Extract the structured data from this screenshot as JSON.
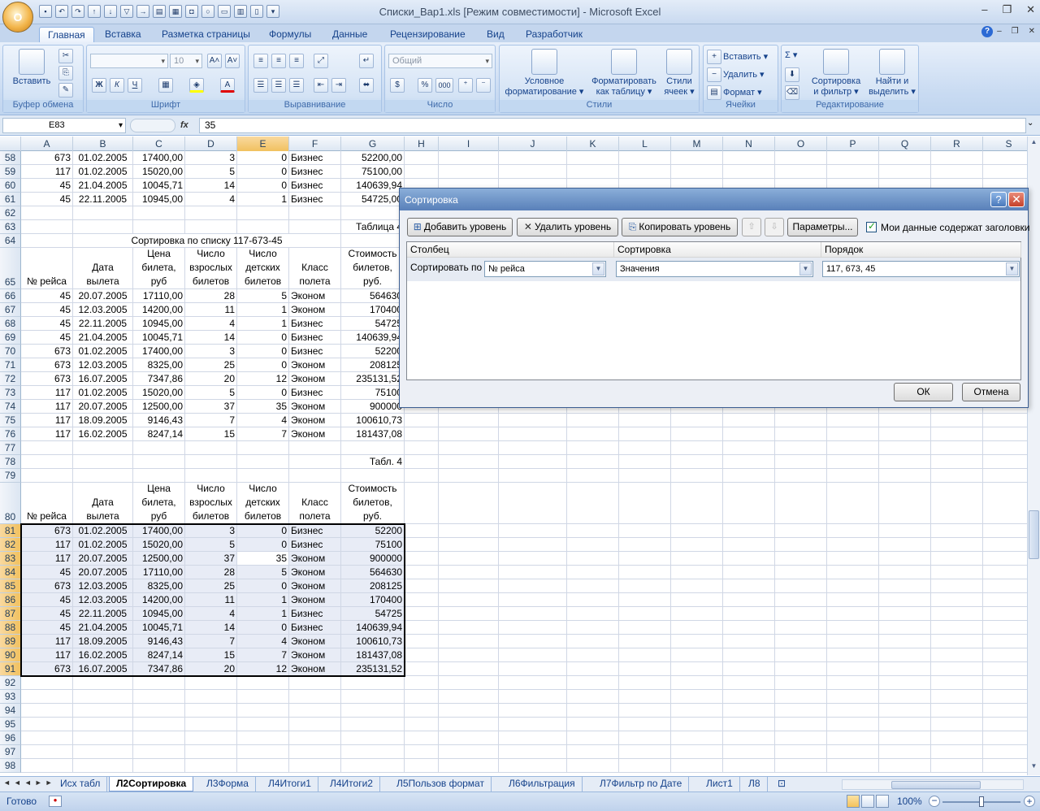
{
  "window": {
    "title": "Списки_Вар1.xls  [Режим совместимости] - Microsoft Excel",
    "minimize": "‒",
    "restore": "❐",
    "close": "✕"
  },
  "office_button": "O",
  "ribbon": {
    "tabs": [
      "Главная",
      "Вставка",
      "Разметка страницы",
      "Формулы",
      "Данные",
      "Рецензирование",
      "Вид",
      "Разработчик"
    ],
    "active_tab": "Главная",
    "groups": {
      "clipboard": {
        "label": "Буфер обмена",
        "paste": "Вставить"
      },
      "font": {
        "label": "Шрифт",
        "font_name": "",
        "font_size": "10",
        "bold": "Ж",
        "italic": "К",
        "underline": "Ч",
        "grow": "A˄",
        "shrink": "A˅"
      },
      "alignment": {
        "label": "Выравнивание"
      },
      "number": {
        "label": "Число",
        "format": "Общий",
        "percent": "%",
        "thousands": "000"
      },
      "styles": {
        "label": "Стили",
        "conditional_1": "Условное",
        "conditional_2": "форматирование ▾",
        "table_1": "Форматировать",
        "table_2": "как таблицу ▾",
        "cell_1": "Стили",
        "cell_2": "ячеек ▾"
      },
      "cells": {
        "label": "Ячейки",
        "insert": "Вставить ▾",
        "delete": "Удалить ▾",
        "format": "Формат ▾"
      },
      "editing": {
        "label": "Редактирование",
        "sigma": "Σ ▾",
        "sort_1": "Сортировка",
        "sort_2": "и фильтр ▾",
        "find_1": "Найти и",
        "find_2": "выделить ▾"
      }
    }
  },
  "formula_bar": {
    "name_box": "E83",
    "fx": "fx",
    "value": "35"
  },
  "grid": {
    "columns": [
      "A",
      "B",
      "C",
      "D",
      "E",
      "F",
      "G",
      "H",
      "I",
      "J",
      "K",
      "L",
      "M",
      "N",
      "O",
      "P",
      "Q",
      "R",
      "S"
    ],
    "selected_column": "E",
    "headers_row": [
      "№ рейса",
      "Дата вылета",
      "Цена билета, руб",
      "Число взрослых билетов",
      "Число детских билетов",
      "Класс полета",
      "Стоимость билетов, руб."
    ],
    "rows_top": [
      {
        "n": "58",
        "a": "673",
        "b": "01.02.2005",
        "c": "17400,00",
        "d": "3",
        "e": "0",
        "f": "Бизнес",
        "g": "52200,00"
      },
      {
        "n": "59",
        "a": "117",
        "b": "01.02.2005",
        "c": "15020,00",
        "d": "5",
        "e": "0",
        "f": "Бизнес",
        "g": "75100,00"
      },
      {
        "n": "60",
        "a": "45",
        "b": "21.04.2005",
        "c": "10045,71",
        "d": "14",
        "e": "0",
        "f": "Бизнес",
        "g": "140639,94"
      },
      {
        "n": "61",
        "a": "45",
        "b": "22.11.2005",
        "c": "10945,00",
        "d": "4",
        "e": "1",
        "f": "Бизнес",
        "g": "54725,00"
      }
    ],
    "row62": "62",
    "row63": {
      "n": "63",
      "label": "Таблица 4"
    },
    "row64": {
      "n": "64",
      "label": "Сортировка по списку 117-673-45"
    },
    "row65": "65",
    "rows_mid": [
      {
        "n": "66",
        "a": "45",
        "b": "20.07.2005",
        "c": "17110,00",
        "d": "28",
        "e": "5",
        "f": "Эконом",
        "g": "564630"
      },
      {
        "n": "67",
        "a": "45",
        "b": "12.03.2005",
        "c": "14200,00",
        "d": "11",
        "e": "1",
        "f": "Эконом",
        "g": "170400"
      },
      {
        "n": "68",
        "a": "45",
        "b": "22.11.2005",
        "c": "10945,00",
        "d": "4",
        "e": "1",
        "f": "Бизнес",
        "g": "54725"
      },
      {
        "n": "69",
        "a": "45",
        "b": "21.04.2005",
        "c": "10045,71",
        "d": "14",
        "e": "0",
        "f": "Бизнес",
        "g": "140639,94"
      },
      {
        "n": "70",
        "a": "673",
        "b": "01.02.2005",
        "c": "17400,00",
        "d": "3",
        "e": "0",
        "f": "Бизнес",
        "g": "52200"
      },
      {
        "n": "71",
        "a": "673",
        "b": "12.03.2005",
        "c": "8325,00",
        "d": "25",
        "e": "0",
        "f": "Эконом",
        "g": "208125"
      },
      {
        "n": "72",
        "a": "673",
        "b": "16.07.2005",
        "c": "7347,86",
        "d": "20",
        "e": "12",
        "f": "Эконом",
        "g": "235131,52"
      },
      {
        "n": "73",
        "a": "117",
        "b": "01.02.2005",
        "c": "15020,00",
        "d": "5",
        "e": "0",
        "f": "Бизнес",
        "g": "75100"
      },
      {
        "n": "74",
        "a": "117",
        "b": "20.07.2005",
        "c": "12500,00",
        "d": "37",
        "e": "35",
        "f": "Эконом",
        "g": "900000"
      },
      {
        "n": "75",
        "a": "117",
        "b": "18.09.2005",
        "c": "9146,43",
        "d": "7",
        "e": "4",
        "f": "Эконом",
        "g": "100610,73"
      },
      {
        "n": "76",
        "a": "117",
        "b": "16.02.2005",
        "c": "8247,14",
        "d": "15",
        "e": "7",
        "f": "Эконом",
        "g": "181437,08"
      }
    ],
    "row77": "77",
    "row78": {
      "n": "78",
      "label": "Табл. 4"
    },
    "row79": "79",
    "row80": "80",
    "rows_bottom": [
      {
        "n": "81",
        "a": "673",
        "b": "01.02.2005",
        "c": "17400,00",
        "d": "3",
        "e": "0",
        "f": "Бизнес",
        "g": "52200"
      },
      {
        "n": "82",
        "a": "117",
        "b": "01.02.2005",
        "c": "15020,00",
        "d": "5",
        "e": "0",
        "f": "Бизнес",
        "g": "75100"
      },
      {
        "n": "83",
        "a": "117",
        "b": "20.07.2005",
        "c": "12500,00",
        "d": "37",
        "e": "35",
        "f": "Эконом",
        "g": "900000"
      },
      {
        "n": "84",
        "a": "45",
        "b": "20.07.2005",
        "c": "17110,00",
        "d": "28",
        "e": "5",
        "f": "Эконом",
        "g": "564630"
      },
      {
        "n": "85",
        "a": "673",
        "b": "12.03.2005",
        "c": "8325,00",
        "d": "25",
        "e": "0",
        "f": "Эконом",
        "g": "208125"
      },
      {
        "n": "86",
        "a": "45",
        "b": "12.03.2005",
        "c": "14200,00",
        "d": "11",
        "e": "1",
        "f": "Эконом",
        "g": "170400"
      },
      {
        "n": "87",
        "a": "45",
        "b": "22.11.2005",
        "c": "10945,00",
        "d": "4",
        "e": "1",
        "f": "Бизнес",
        "g": "54725"
      },
      {
        "n": "88",
        "a": "45",
        "b": "21.04.2005",
        "c": "10045,71",
        "d": "14",
        "e": "0",
        "f": "Бизнес",
        "g": "140639,94"
      },
      {
        "n": "89",
        "a": "117",
        "b": "18.09.2005",
        "c": "9146,43",
        "d": "7",
        "e": "4",
        "f": "Эконом",
        "g": "100610,73"
      },
      {
        "n": "90",
        "a": "117",
        "b": "16.02.2005",
        "c": "8247,14",
        "d": "15",
        "e": "7",
        "f": "Эконом",
        "g": "181437,08"
      },
      {
        "n": "91",
        "a": "673",
        "b": "16.07.2005",
        "c": "7347,86",
        "d": "20",
        "e": "12",
        "f": "Эконом",
        "g": "235131,52"
      }
    ],
    "empty_rows": [
      "92",
      "93",
      "94",
      "95",
      "96",
      "97",
      "98"
    ]
  },
  "dialog": {
    "title": "Сортировка",
    "help": "?",
    "close": "✕",
    "add_level": "Добавить уровень",
    "delete_level": "Удалить уровень",
    "copy_level": "Копировать уровень",
    "move_up": "⇧",
    "move_down": "⇩",
    "options": "Параметры...",
    "has_headers": "Мои данные содержат заголовки",
    "col_header_column": "Столбец",
    "col_header_sort": "Сортировка",
    "col_header_order": "Порядок",
    "sort_by": "Сортировать по",
    "column_value": "№ рейса",
    "sort_on_value": "Значения",
    "order_value": "117, 673, 45",
    "ok": "ОК",
    "cancel": "Отмена"
  },
  "sheet_tabs": {
    "nav": "◄◄◄►►",
    "tabs": [
      "Исх табл",
      "Л2Сортировка",
      "Л3Форма",
      "Л4Итоги1",
      "Л4Итоги2",
      "Л5Пользов формат",
      "Л6Фильтрация",
      "Л7Фильтр по Дате",
      "Лист1",
      "Л8"
    ],
    "active": "Л2Сортировка"
  },
  "status": {
    "ready": "Готово",
    "zoom": "100%"
  }
}
